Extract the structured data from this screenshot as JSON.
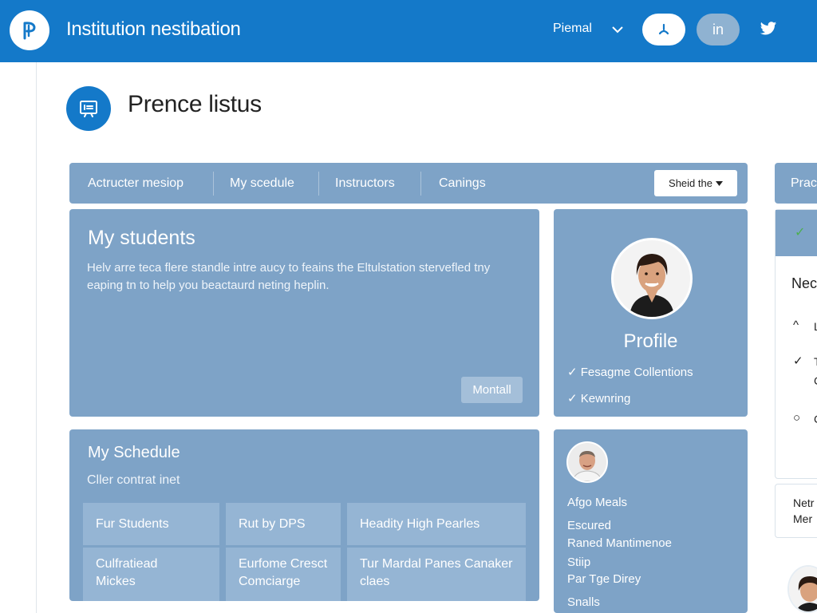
{
  "colors": {
    "primary": "#1479c9",
    "card": "#7ea3c7",
    "cell": "#95b5d4"
  },
  "header": {
    "logo_icon": "logo-p-icon",
    "title": "Institution nestibation",
    "user_menu": "Piemal",
    "user_button_icon": "user-icon",
    "in_button": "in",
    "social_icon": "twitter-icon"
  },
  "page": {
    "icon": "presentation-icon",
    "title": "Prence listus"
  },
  "tabs": [
    {
      "label": "Actructer mesiop"
    },
    {
      "label": "My scedule"
    },
    {
      "label": "Instructors"
    },
    {
      "label": "Canings"
    }
  ],
  "share_button": "Sheid the",
  "right_tab": "Prac",
  "students": {
    "title": "My students",
    "body": "Helv arre teca flere standle intre aucy to feains the Eltulstation stervefled tny eaping tn to help you beactaurd neting heplin.",
    "button": "Montall"
  },
  "profile": {
    "title": "Profile",
    "items": [
      "Fesagme Collentions",
      "Kewnring"
    ]
  },
  "schedule": {
    "title": "My Schedule",
    "subtitle": "Cller contrat inet",
    "cells": [
      "Fur Students",
      "Rut by DPS",
      "Headity High Pearles",
      "Culfratiead Mickes",
      "Eurfome Cresct Comciarge",
      "Tur Mardal Panes Canaker claes"
    ]
  },
  "people": {
    "items": [
      "Afgo Meals",
      "Escured",
      "Raned Mantimenoe",
      "Stiip",
      "Par Tge Direy",
      "Snalls"
    ]
  },
  "right_panel": {
    "heading": "Nec",
    "rows": [
      "L",
      "T",
      "C",
      "C"
    ],
    "card2_line1": "Netr",
    "card2_line2": "Mer"
  }
}
